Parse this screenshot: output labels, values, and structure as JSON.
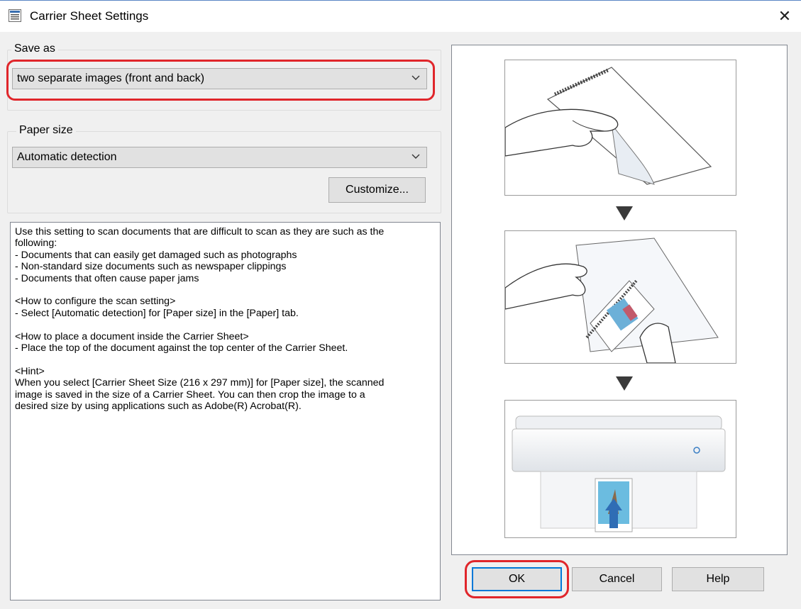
{
  "window": {
    "title": "Carrier Sheet Settings",
    "close_glyph": "✕",
    "icon": "settings-window-icon"
  },
  "save_as": {
    "label": "Save as",
    "selected": "two separate images (front and back)"
  },
  "paper_size": {
    "label": "Paper size",
    "selected": "Automatic detection",
    "customize_label": "Customize..."
  },
  "description": {
    "lines": [
      "Use this setting to scan documents that are difficult to scan as they are such as the",
      "following:",
      "- Documents that can easily get damaged such as photographs",
      "- Non-standard size documents such as newspaper clippings",
      "- Documents that often cause paper jams",
      "",
      "<How to configure the scan setting>",
      "- Select [Automatic detection] for [Paper size] in the [Paper] tab.",
      "",
      "<How to place a document inside the Carrier Sheet>",
      "- Place the top of the document against the top center of the Carrier Sheet.",
      "",
      "<Hint>",
      "When you select [Carrier Sheet Size (216 x 297 mm)] for [Paper size], the scanned",
      "image is saved in the size of a Carrier Sheet. You can then crop the image to a",
      "desired size by using applications such as Adobe(R) Acrobat(R)."
    ]
  },
  "buttons": {
    "ok": "OK",
    "cancel": "Cancel",
    "help": "Help"
  },
  "colors": {
    "highlight": "#e0262b",
    "focus": "#0078d7",
    "scanner_arrow": "#2f6db5"
  }
}
